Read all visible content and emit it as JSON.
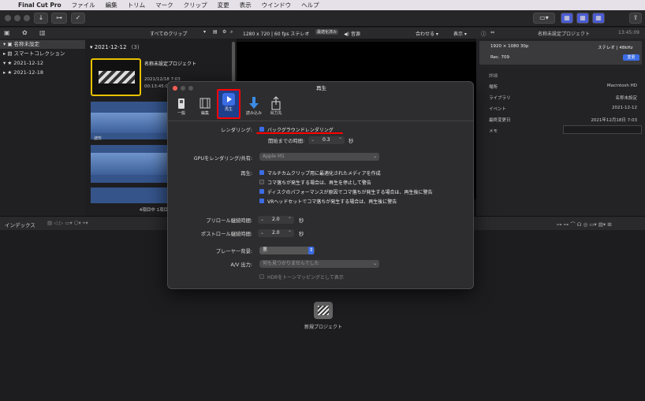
{
  "menubar": {
    "apple": "",
    "items": [
      "Final Cut Pro",
      "ファイル",
      "編集",
      "トリム",
      "マーク",
      "クリップ",
      "変更",
      "表示",
      "ウインドウ",
      "ヘルプ"
    ]
  },
  "library": {
    "header_label": "",
    "root": "名称未設定",
    "items": [
      "スマートコレクション",
      "2021-12-12",
      "2021-12-18"
    ]
  },
  "browser": {
    "filter_label": "すべてのクリップ",
    "date_group": "2021-12-12",
    "date_count": "(3)",
    "project_title": "名称未設定プロジェクト",
    "project_date": "2021/12/18 7:03",
    "project_duration": "00:13:45:09",
    "clip_label": "波形",
    "selection_status": "4項目中 1項目を選択,"
  },
  "viewer": {
    "format": "1280 x 720 | 60 fps ステレオ",
    "proxy_badge": "最適化済み",
    "audio_label": "音源",
    "fit_label": "合わせる",
    "display_label": "表示"
  },
  "inspector": {
    "title": "名称未設定プロジェクト",
    "timecode": "13:45:09",
    "resolution": "1920 × 1080 30p",
    "audio": "ステレオ | 48kHz",
    "color": "Rec. 709",
    "modify_button": "変更",
    "section": "詳細",
    "rows": [
      {
        "label": "場所",
        "value": "Macintosh HD"
      },
      {
        "label": "ライブラリ",
        "value": "名称未設定"
      },
      {
        "label": "イベント",
        "value": "2021-12-12"
      },
      {
        "label": "最終変更日",
        "value": "2021年12月18日 7:03"
      },
      {
        "label": "メモ",
        "value": ""
      }
    ]
  },
  "timeline": {
    "index_label": "インデックス",
    "empty_label": "新規プロジェクト"
  },
  "dialog": {
    "title": "再生",
    "tabs": [
      {
        "label": "一般",
        "icon": "switch-icon"
      },
      {
        "label": "編集",
        "icon": "film-icon"
      },
      {
        "label": "再生",
        "icon": "play-icon"
      },
      {
        "label": "読み込み",
        "icon": "download-icon"
      },
      {
        "label": "出力先",
        "icon": "share-icon"
      }
    ],
    "rendering_label": "レンダリング:",
    "background_render": "バックグラウンドレンダリング",
    "start_after_label": "開始までの時間:",
    "start_after_value": "0.3",
    "seconds": "秒",
    "gpu_label": "GPUをレンダリング/共有:",
    "gpu_value": "Apple M1",
    "playback_label": "再生:",
    "playback_options": [
      {
        "text": "マルチカムクリップ用に最適化されたメディアを作成",
        "checked": true
      },
      {
        "text": "コマ落ちが発生する場合は、再生を停止して警告",
        "checked": false
      },
      {
        "text": "ディスクのパフォーマンスが原因でコマ落ちが発生する場合は、再生後に警告",
        "checked": true
      },
      {
        "text": "VRヘッドセットでコマ落ちが発生する場合は、再生後に警告",
        "checked": true
      }
    ],
    "preroll_label": "プリロール継続時間:",
    "preroll_value": "2.0",
    "postroll_label": "ポストロール継続時間:",
    "postroll_value": "2.0",
    "bg_label": "プレーヤー背景:",
    "bg_value": "黒",
    "av_label": "A/V 出力:",
    "av_value": "何も見つかりませんでした",
    "hdr_label": "HDRをトーンマッピングとして表示"
  },
  "colors": {
    "accent": "#3b6ce4",
    "highlight": "#ff0000"
  }
}
